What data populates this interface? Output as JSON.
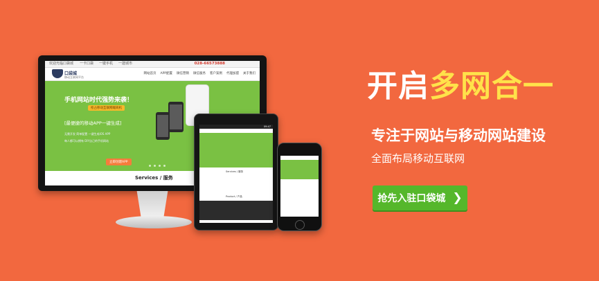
{
  "banner": {
    "headline_part1": "开启",
    "headline_part2": "多网合一",
    "subheadline": "专注于网站与移动网站建设",
    "tagline": "全面布局移动互联网",
    "cta_label": "抢先入驻口袋城",
    "cta_icon": "chevron-right-icon"
  },
  "monitor_site": {
    "topbar": [
      "欢迎光临口袋城",
      "一卡口袋",
      "一键手机",
      "一建城市"
    ],
    "phone": "028-66573888",
    "logo_text": "口袋城",
    "logo_sub": "移动互联网平台",
    "nav": [
      "网站首页",
      "APP配置",
      "微信营销",
      "微信服务",
      "客户案例",
      "代理加盟",
      "关于我们"
    ],
    "hero_title": "手机网站时代强势来袭！",
    "hero_badge": "抢占移动互联网端商机",
    "hero_sub": "[最便捷的移动APP一键生成]",
    "hero_lines": [
      "无需开发 简单配置 一键生成IOS APP",
      "每人都可以拥有 DIY自己的手机网站"
    ],
    "hero_button": "立即创建APP",
    "below_text": "Services / 服务"
  },
  "tablet_site": {
    "status": "09:47",
    "section1": "Services / 服务",
    "section2": "Product / 产品"
  },
  "colors": {
    "background": "#f2683f",
    "headline_accent": "#ffe24a",
    "cta": "#55b72b",
    "site_green": "#7ac143"
  }
}
